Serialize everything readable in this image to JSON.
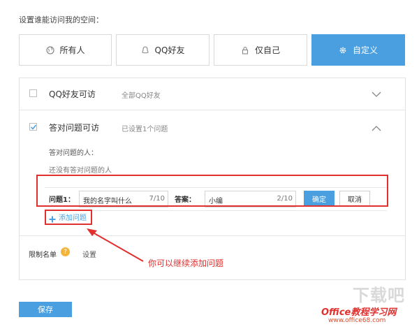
{
  "header": {
    "title": "设置谁能访问我的空间："
  },
  "tabs": [
    {
      "label": "所有人",
      "icon": "globe-icon"
    },
    {
      "label": "QQ好友",
      "icon": "person-icon"
    },
    {
      "label": "仅自己",
      "icon": "lock-icon"
    },
    {
      "label": "自定义",
      "icon": "gear-icon",
      "active": true
    }
  ],
  "options": {
    "qq_friends": {
      "label": "QQ好友可访",
      "sub": "全部QQ好友",
      "checked": false
    },
    "answer": {
      "label": "答对问题可访",
      "sub": "已设置1个问题",
      "checked": true,
      "people_label": "答对问题的人：",
      "empty_text": "还没有答对问题的人"
    }
  },
  "question": {
    "q_label": "问题1：",
    "q_value": "我的名字叫什么",
    "q_count": "7/10",
    "a_label": "答案：",
    "a_value": "小编",
    "a_count": "2/10",
    "confirm": "确定",
    "cancel": "取消"
  },
  "add_question": "添加问题",
  "restriction": {
    "label": "限制名单",
    "help": "?",
    "settings": "设置"
  },
  "annotation": "你可以继续添加问题",
  "save": "保存",
  "watermark": {
    "text": "Office教程学习网",
    "url": "www.office68.com",
    "logo": "下载吧"
  },
  "colors": {
    "accent": "#4a9fe0",
    "annotation_red": "#e0312f",
    "help_yellow": "#f2b43b"
  }
}
